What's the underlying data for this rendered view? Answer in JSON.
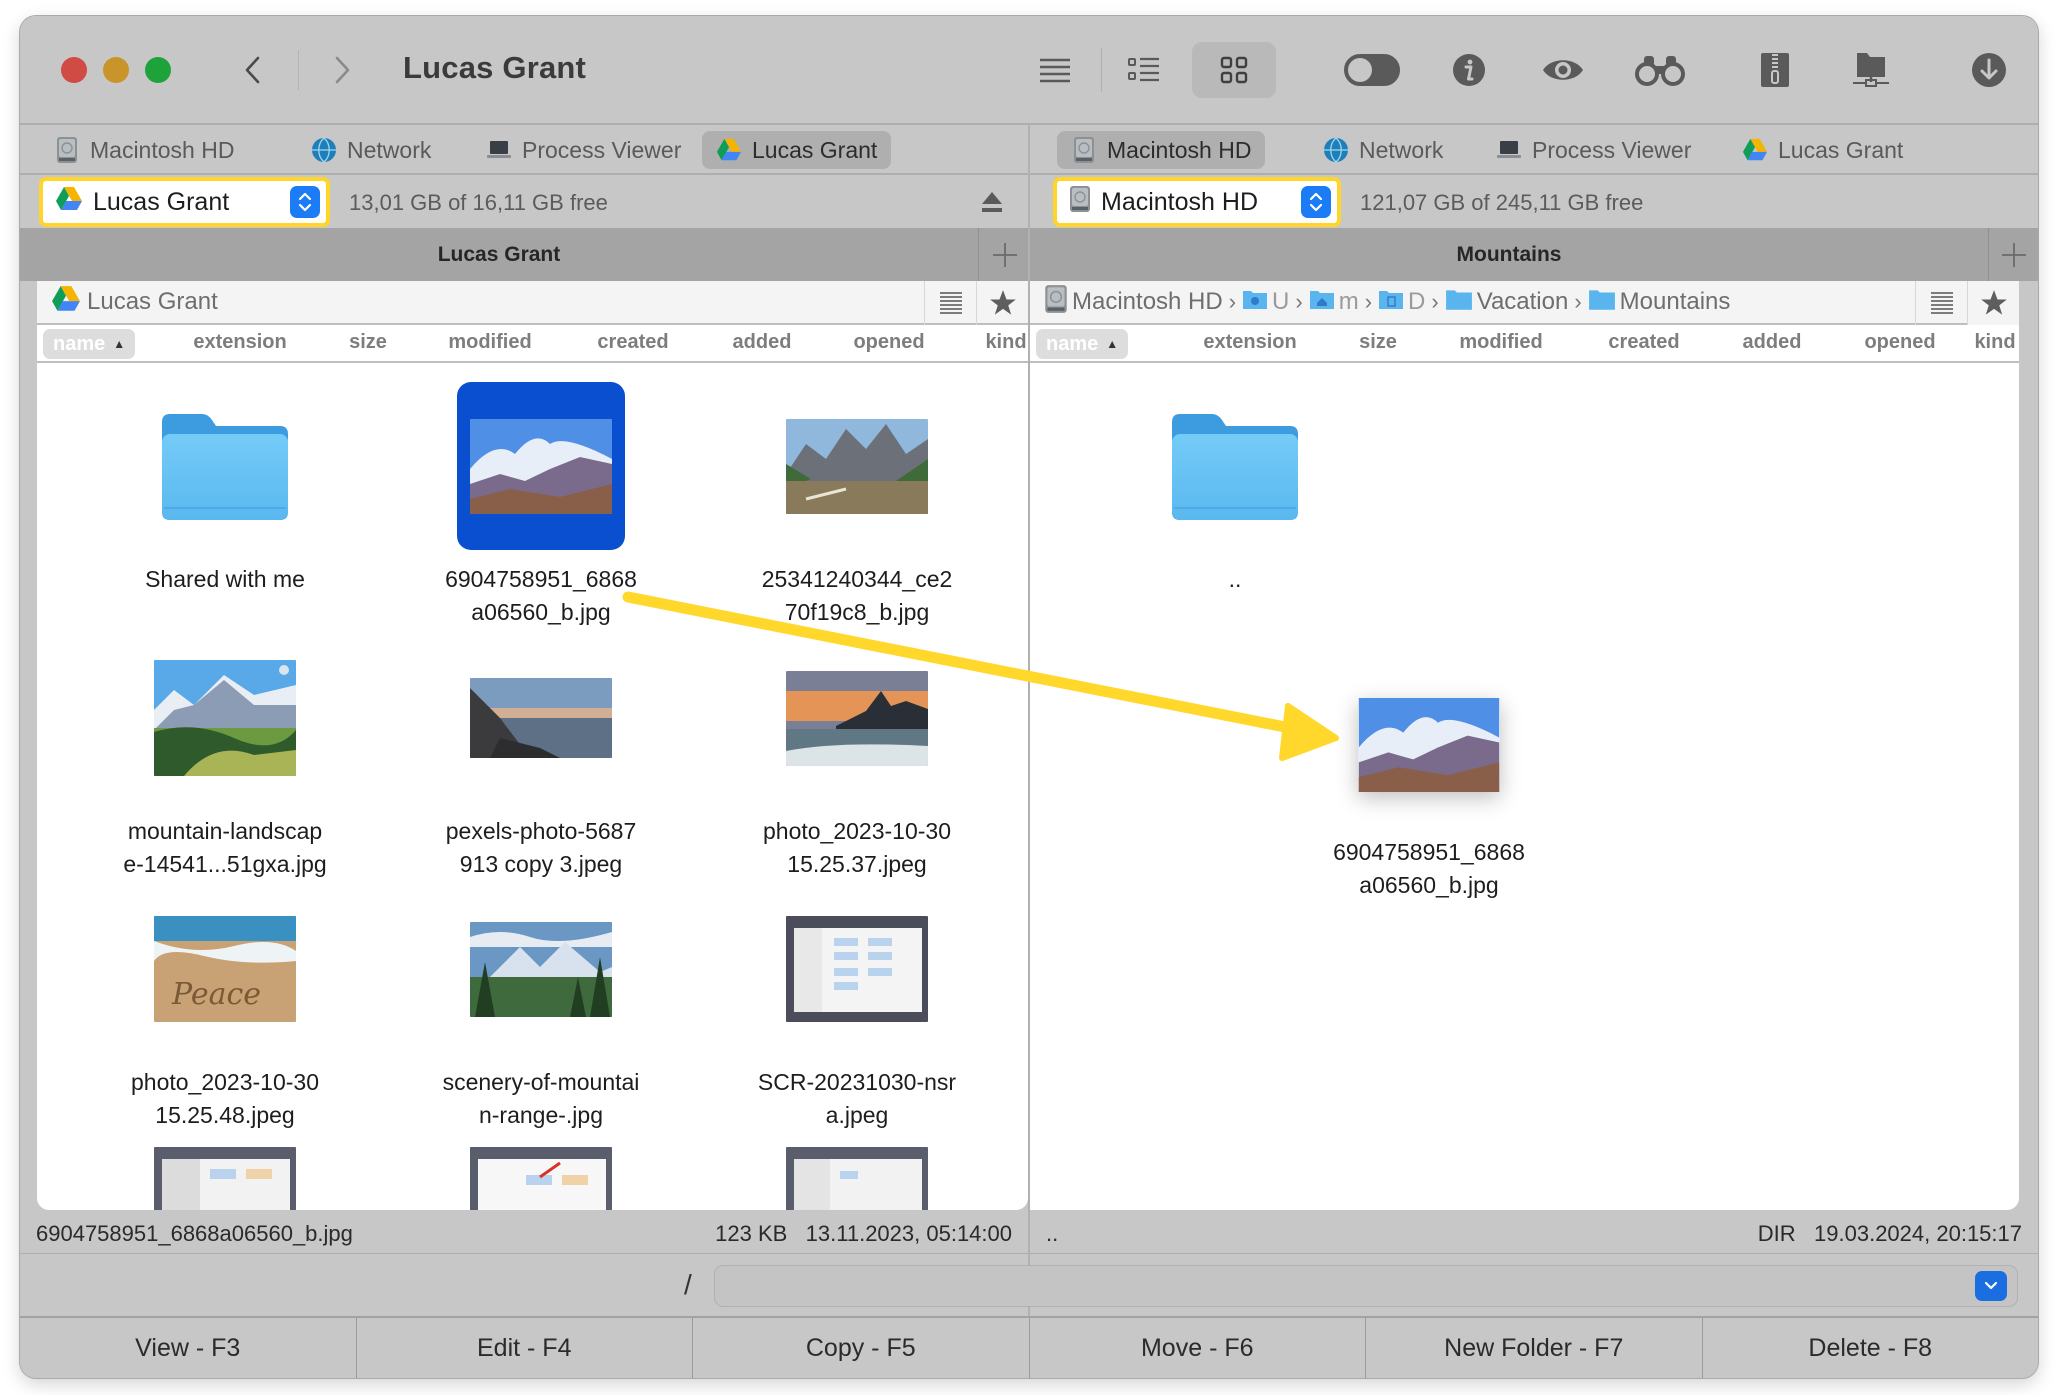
{
  "window": {
    "title": "Lucas Grant"
  },
  "toolbar": {
    "buttons": [
      {
        "name": "brief-list-view",
        "icon": "list-icon",
        "active": false
      },
      {
        "name": "detailed-list-view",
        "icon": "detail-list-icon",
        "active": false
      },
      {
        "name": "thumbnail-view",
        "icon": "grid-icon",
        "active": true
      },
      {
        "name": "hidden-files-toggle",
        "icon": "toggle-icon",
        "active": false
      },
      {
        "name": "info",
        "icon": "info-icon",
        "active": false
      },
      {
        "name": "quick-look",
        "icon": "eye-icon",
        "active": false
      },
      {
        "name": "search",
        "icon": "binoculars-icon",
        "active": false
      },
      {
        "name": "archive",
        "icon": "zip-icon",
        "active": false
      },
      {
        "name": "network-connect",
        "icon": "network-folder-icon",
        "active": false
      },
      {
        "name": "download",
        "icon": "download-icon",
        "active": false
      }
    ]
  },
  "left_pane": {
    "tabs": [
      {
        "label": "Macintosh HD",
        "icon": "hard-drive-icon",
        "active": false
      },
      {
        "label": "Network",
        "icon": "globe-icon",
        "active": false
      },
      {
        "label": "Process Viewer",
        "icon": "laptop-icon",
        "active": false
      },
      {
        "label": "Lucas Grant",
        "icon": "google-drive-icon",
        "active": true
      }
    ],
    "volume": {
      "name": "Lucas Grant",
      "icon": "google-drive-icon",
      "free": "13,01 GB of 16,11 GB free"
    },
    "header": "Lucas Grant",
    "breadcrumb": [
      {
        "label": "Lucas Grant",
        "icon": "google-drive-icon"
      }
    ],
    "columns": [
      "name",
      "extension",
      "size",
      "modified",
      "created",
      "added",
      "opened",
      "kind"
    ],
    "sort": {
      "column": "name",
      "direction": "ascending"
    },
    "items": [
      {
        "label": "Shared with me",
        "type": "folder",
        "selected": false
      },
      {
        "label": "6904758951_6868\na06560_b.jpg",
        "type": "image",
        "thumb": "mountain-clouds",
        "selected": true
      },
      {
        "label": "25341240344_ce2\n70f19c8_b.jpg",
        "type": "image",
        "thumb": "alpine-lake",
        "selected": false
      },
      {
        "label": "mountain-landscap\ne-14541...51gxa.jpg",
        "type": "image",
        "thumb": "snowy-peak",
        "selected": false
      },
      {
        "label": "pexels-photo-5687\n913 copy 3.jpeg",
        "type": "image",
        "thumb": "coast-sunset",
        "selected": false
      },
      {
        "label": "photo_2023-10-30\n15.25.37.jpeg",
        "type": "image",
        "thumb": "beach-sunset",
        "selected": false
      },
      {
        "label": "photo_2023-10-30\n15.25.48.jpeg",
        "type": "image",
        "thumb": "sand-peace",
        "selected": false
      },
      {
        "label": "scenery-of-mountai\nn-range-.jpg",
        "type": "image",
        "thumb": "valley-forest",
        "selected": false
      },
      {
        "label": "SCR-20231030-nsr\na.jpeg",
        "type": "image",
        "thumb": "screenshot",
        "selected": false
      },
      {
        "label": "",
        "type": "image",
        "thumb": "screenshot",
        "selected": false
      },
      {
        "label": "",
        "type": "image",
        "thumb": "screenshot",
        "selected": false
      },
      {
        "label": "",
        "type": "image",
        "thumb": "screenshot",
        "selected": false
      }
    ],
    "status": {
      "name": "6904758951_6868a06560_b.jpg",
      "size": "123 KB",
      "date": "13.11.2023, 05:14:00"
    }
  },
  "right_pane": {
    "tabs": [
      {
        "label": "Macintosh HD",
        "icon": "hard-drive-icon",
        "active": true
      },
      {
        "label": "Network",
        "icon": "globe-icon",
        "active": false
      },
      {
        "label": "Process Viewer",
        "icon": "laptop-icon",
        "active": false
      },
      {
        "label": "Lucas Grant",
        "icon": "google-drive-icon",
        "active": false
      }
    ],
    "volume": {
      "name": "Macintosh HD",
      "icon": "hard-drive-icon",
      "free": "121,07 GB of 245,11 GB free"
    },
    "header": "Mountains",
    "breadcrumb": [
      {
        "label": "Macintosh HD",
        "icon": "hard-drive-icon"
      },
      {
        "label": "U",
        "icon": "users-folder-icon",
        "dim": true
      },
      {
        "label": "m",
        "icon": "home-folder-icon",
        "dim": true
      },
      {
        "label": "D",
        "icon": "documents-folder-icon",
        "dim": true
      },
      {
        "label": "Vacation",
        "icon": "folder-icon"
      },
      {
        "label": "Mountains",
        "icon": "folder-icon"
      }
    ],
    "columns": [
      "name",
      "extension",
      "size",
      "modified",
      "created",
      "added",
      "opened",
      "kind"
    ],
    "sort": {
      "column": "name",
      "direction": "ascending"
    },
    "items": [
      {
        "label": "..",
        "type": "folder"
      }
    ],
    "drag_item": {
      "label": "6904758951_6868\na06560_b.jpg",
      "thumb": "mountain-clouds"
    },
    "status": {
      "name": "..",
      "size": "DIR",
      "date": "19.03.2024, 20:15:17"
    }
  },
  "command_line": {
    "prompt": "/",
    "value": ""
  },
  "function_keys": [
    {
      "label": "View - F3"
    },
    {
      "label": "Edit - F4"
    },
    {
      "label": "Copy - F5"
    },
    {
      "label": "Move - F6"
    },
    {
      "label": "New Folder - F7"
    },
    {
      "label": "Delete - F8"
    }
  ],
  "annotation": {
    "type": "arrow",
    "color": "#ffd82b",
    "meaning": "drag file from left pane to right pane"
  },
  "colors": {
    "selection": "#0b4fd1",
    "highlight_border": "#ffd52a",
    "stepper": "#1b7cf5"
  }
}
